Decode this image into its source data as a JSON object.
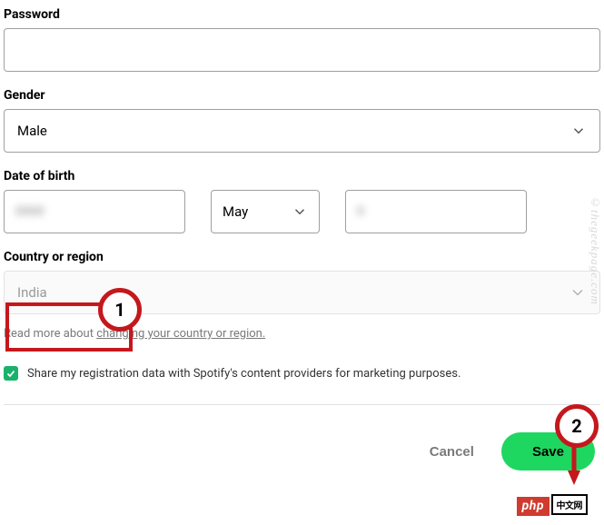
{
  "password": {
    "label": "Password",
    "value": ""
  },
  "gender": {
    "label": "Gender",
    "value": "Male"
  },
  "dob": {
    "label": "Date of birth",
    "month": "May"
  },
  "country": {
    "label": "Country or region",
    "value": "India",
    "readmore_prefix": "Read more about ",
    "readmore_link": "changing your country or region."
  },
  "marketing": {
    "checked": true,
    "label": "Share my registration data with Spotify's content providers for marketing purposes."
  },
  "buttons": {
    "cancel": "Cancel",
    "save": "Save"
  },
  "annotations": {
    "step1": "1",
    "step2": "2"
  },
  "overlay": {
    "php": "php",
    "cn": "中文网"
  },
  "watermark": "©thegeekpage.com"
}
